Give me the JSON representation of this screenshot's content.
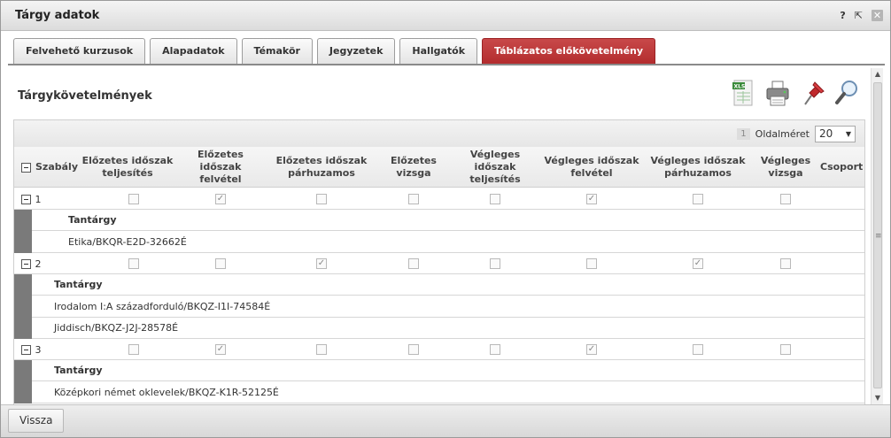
{
  "window": {
    "title": "Tárgy adatok",
    "help": "?",
    "popout": "⇱",
    "close": "✕"
  },
  "tabs": [
    {
      "label": "Felvehető kurzusok",
      "active": false
    },
    {
      "label": "Alapadatok",
      "active": false
    },
    {
      "label": "Témakör",
      "active": false
    },
    {
      "label": "Jegyzetek",
      "active": false
    },
    {
      "label": "Hallgatók",
      "active": false
    },
    {
      "label": "Táblázatos előkövetelmény",
      "active": true
    }
  ],
  "section": {
    "title": "Tárgykövetelmények"
  },
  "toolbar": {
    "icons": [
      "xls-export-icon",
      "print-icon",
      "pin-icon",
      "search-icon"
    ],
    "xls_label": "XLS"
  },
  "pager": {
    "current_page": "1",
    "page_size_label": "Oldalméret",
    "page_size": "20"
  },
  "grid": {
    "columns": [
      "Szabály",
      "Előzetes időszak teljesítés",
      "Előzetes időszak felvétel",
      "Előzetes időszak párhuzamos",
      "Előzetes vizsga",
      "Végleges időszak teljesítés",
      "Végleges időszak felvétel",
      "Végleges időszak párhuzamos",
      "Végleges vizsga",
      "Csoport"
    ],
    "rows": [
      {
        "id": "1",
        "checks": [
          false,
          true,
          false,
          false,
          false,
          true,
          false,
          false
        ],
        "detail_header": "Tantárgy",
        "subjects": [
          "Etika/BKQR-E2D-32662É"
        ]
      },
      {
        "id": "2",
        "checks": [
          false,
          false,
          true,
          false,
          false,
          false,
          true,
          false
        ],
        "detail_header": "Tantárgy",
        "subjects": [
          "Irodalom I:A századforduló/BKQZ-I1I-74584É",
          "Jiddisch/BKQZ-J2J-28578É"
        ]
      },
      {
        "id": "3",
        "checks": [
          false,
          true,
          false,
          false,
          false,
          true,
          false,
          false
        ],
        "detail_header": "Tantárgy",
        "subjects": [
          "Középkori német oklevelek/BKQZ-K1R-52125É"
        ]
      }
    ]
  },
  "footer": {
    "back_label": "Vissza"
  }
}
